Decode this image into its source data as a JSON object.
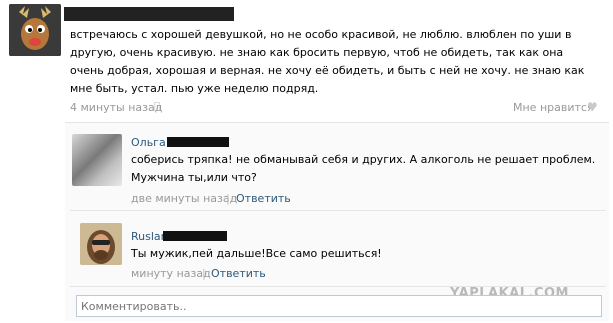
{
  "post": {
    "text": "встречаюсь с хорошей девушкой, но не особо красивой, не люблю. влюблен по уши в другую, очень красивую. не знаю как бросить первую, чтоб не обидеть, так как она очень добрая, хорошая и верная. не хочу её обидеть, и быть с ней не хочу. не знаю как мне быть, устал. пью уже неделю подряд.",
    "time": "4 минуты назад",
    "like_label": "Мне нравится",
    "apple_icon": "apple-icon",
    "heart_icon": "heart-icon"
  },
  "comments": [
    {
      "author": "Ольга",
      "text": "соберись тряпка! не обманывай себя и других. А алкоголь не решает проблем. Мужчина ты,или что?",
      "time": "две минуты назад",
      "reply_label": "Ответить"
    },
    {
      "author": "Ruslan",
      "text": "Ты мужик,пей дальше!Все само решиться!",
      "time": "минуту назад",
      "reply_label": "Ответить"
    }
  ],
  "comment_input": {
    "placeholder": "Комментировать.."
  },
  "separator": "|",
  "watermark": "YAPLAKAL.COM",
  "colors": {
    "link": "#2b587a",
    "meta": "#999999",
    "redaction": "#111111"
  }
}
